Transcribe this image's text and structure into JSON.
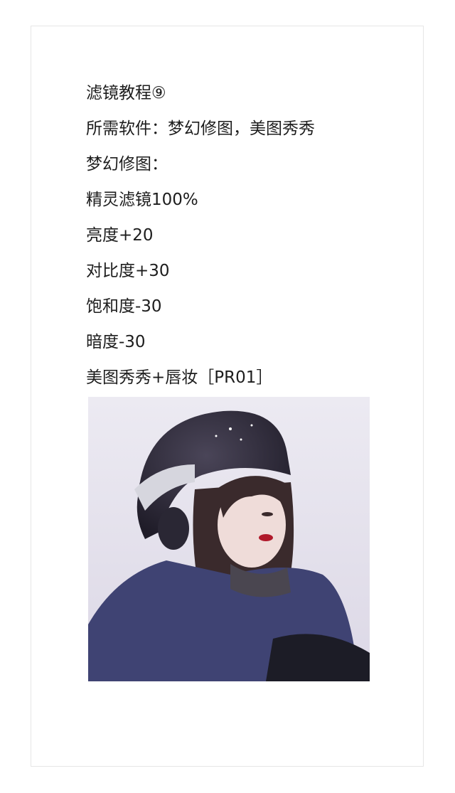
{
  "article": {
    "lines": [
      "滤镜教程⑨",
      "所需软件：梦幻修图，美图秀秀",
      "梦幻修图：",
      "精灵滤镜100%",
      "亮度+20",
      "对比度+30",
      "饱和度-30",
      "暗度-30",
      "美图秀秀+唇妆［PR01］"
    ]
  },
  "photo": {
    "subject": "girl-in-ski-helmet-photo",
    "palette": {
      "snow": "#e6e3ee",
      "helmet": "#2a2734",
      "jacket": "#3f4373",
      "hair": "#3a2a2c",
      "skin": "#efdcd9",
      "lips": "#b0192a"
    }
  }
}
